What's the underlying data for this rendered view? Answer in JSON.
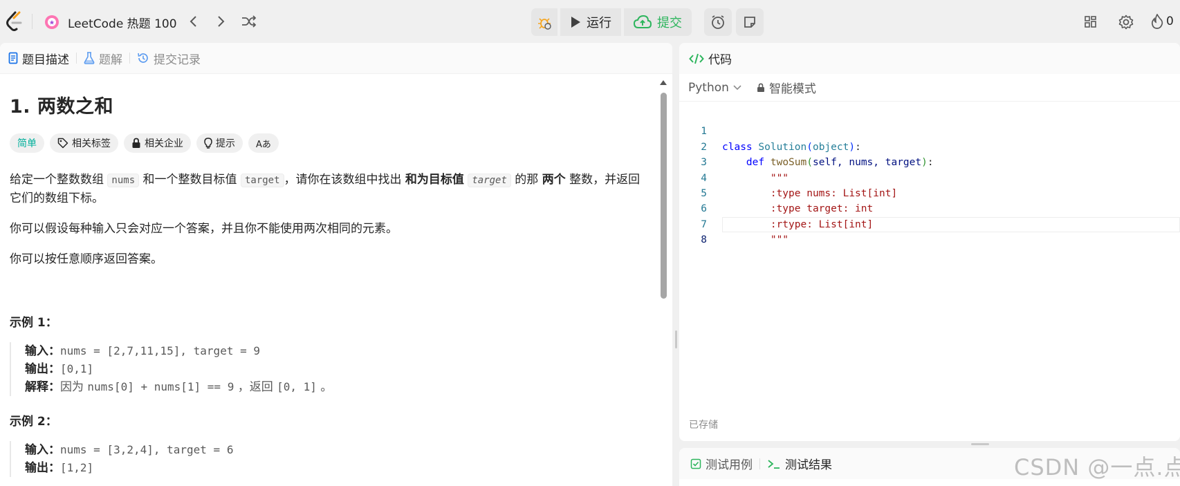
{
  "topbar": {
    "list_title": "LeetCode 热题 100",
    "run_label": "运行",
    "submit_label": "提交",
    "streak_count": "0",
    "colors": {
      "submit": "#2db55d",
      "debug_icon": "#f5a623"
    }
  },
  "left_tabs": [
    {
      "label": "题目描述",
      "icon": "document-icon"
    },
    {
      "label": "题解",
      "icon": "flask-icon"
    },
    {
      "label": "提交记录",
      "icon": "history-icon"
    }
  ],
  "problem": {
    "title": "1. 两数之和",
    "tags": {
      "difficulty": "简单",
      "related_tags": "相关标签",
      "related_companies": "相关企业",
      "hint": "提示",
      "translate": "Aあ"
    },
    "difficulty_color": "#00af9b",
    "p1": {
      "t1": "给定一个整数数组 ",
      "c1": "nums",
      "t2": " 和一个整数目标值 ",
      "c2": "target",
      "t3": "，请你在该数组中找出 ",
      "b1": "和为目标值",
      "c3": "target",
      "t4": " 的那 ",
      "b2": "两个",
      "t5": " 整数，并返回它们的数组下标。"
    },
    "p2": "你可以假设每种输入只会对应一个答案，并且你不能使用两次相同的元素。",
    "p3": "你可以按任意顺序返回答案。",
    "examples": [
      {
        "title": "示例 1：",
        "input_label": "输入：",
        "input": "nums = [2,7,11,15], target = 9",
        "output_label": "输出：",
        "output": "[0,1]",
        "explain_label": "解释：",
        "explain_t1": "因为 ",
        "explain_c": "nums[0] + nums[1] == 9",
        "explain_t2": " ，返回 ",
        "explain_c2": "[0, 1]",
        "explain_t3": " 。"
      },
      {
        "title": "示例 2：",
        "input_label": "输入：",
        "input": "nums = [3,2,4], target = 6",
        "output_label": "输出：",
        "output": "[1,2]"
      }
    ]
  },
  "code_panel": {
    "title": "代码",
    "language": "Python",
    "mode": "智能模式",
    "saved_status": "已存储",
    "lines": [
      {
        "n": "1"
      },
      {
        "n": "2"
      },
      {
        "n": "3"
      },
      {
        "n": "4"
      },
      {
        "n": "5"
      },
      {
        "n": "6"
      },
      {
        "n": "7"
      },
      {
        "n": "8"
      }
    ],
    "code": {
      "l1_kw": "class",
      "l1_cls": "Solution",
      "l1_base": "object",
      "l2_kw": "def",
      "l2_fn": "twoSum",
      "l2_params": "self, nums, target",
      "l3": "\"\"\"",
      "l4": ":type nums: List[int]",
      "l5": ":type target: int",
      "l6": ":rtype: List[int]",
      "l7": "\"\"\""
    }
  },
  "test_panel": {
    "tab1": "测试用例",
    "tab2": "测试结果"
  },
  "watermark": "CSDN @一点.点"
}
